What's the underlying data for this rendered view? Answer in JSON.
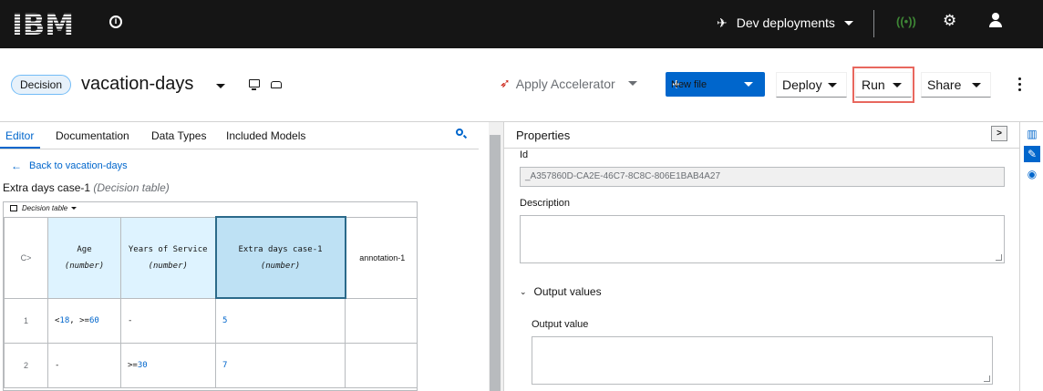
{
  "topbar": {
    "logo_text": "IBM",
    "info_icon": "info-icon",
    "space_label": "Dev deployments",
    "satellite_icon": "satellite-icon",
    "signal_icon": "signal-icon",
    "gear_icon": "gear-icon",
    "user_icon": "user-icon"
  },
  "header": {
    "badge": "Decision",
    "file_name": "vacation-days",
    "apply_accelerator": "Apply Accelerator",
    "new_file": "New file",
    "deploy": "Deploy",
    "run": "Run",
    "share": "Share",
    "colors": {
      "primary": "#0066cc",
      "highlight": "#e8675e",
      "dark": "#151515"
    }
  },
  "editor": {
    "tabs": [
      "Editor",
      "Documentation",
      "Data Types",
      "Included Models"
    ],
    "back_link": "Back to vacation-days",
    "decision_name": "Extra days case-1",
    "decision_type": "(Decision table)",
    "toolbar_label": "Decision table",
    "table": {
      "hit_policy": "C>",
      "columns": [
        {
          "name": "Age",
          "type": "(number)"
        },
        {
          "name": "Years of Service",
          "type": "(number)"
        },
        {
          "name": "Extra days case-1",
          "type": "(number)"
        }
      ],
      "annotation": "annotation-1",
      "rows": [
        {
          "num": "1",
          "c1_a": "<",
          "c1_b": "18",
          "c1_c": ", >=",
          "c1_d": "60",
          "c2": "-",
          "out": "5",
          "ann": ""
        },
        {
          "num": "2",
          "c1_a": "-",
          "c1_b": "",
          "c1_c": "",
          "c1_d": "",
          "c2_a": ">=",
          "c2_b": "30",
          "out": "7",
          "ann": ""
        }
      ]
    }
  },
  "properties": {
    "title": "Properties",
    "id_label": "Id",
    "id_value": "_A357860D-CA2E-46C7-8C8C-806E1BAB4A27",
    "description_label": "Description",
    "output_values_label": "Output values",
    "output_value_label": "Output value"
  }
}
